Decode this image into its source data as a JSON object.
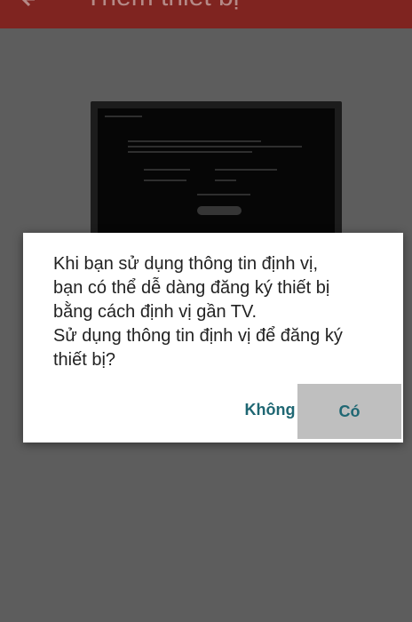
{
  "appbar": {
    "title": "Thêm thiết bị",
    "back_icon": "arrow-back-icon"
  },
  "dialog": {
    "message_lines": [
      "Khi bạn sử dụng thông tin định vị,",
      "bạn có thể dễ dàng đăng ký thiết bị",
      "bằng cách định vị gần TV.",
      "Sử dụng thông tin định vị để đăng ký",
      "thiết bị?"
    ],
    "negative_button": "Không",
    "positive_button": "Có"
  },
  "colors": {
    "appbar": "#7f2420",
    "scrim": "#5d5d5d",
    "button_text": "#1f6773",
    "pressed_button": "#bfbfbf"
  }
}
